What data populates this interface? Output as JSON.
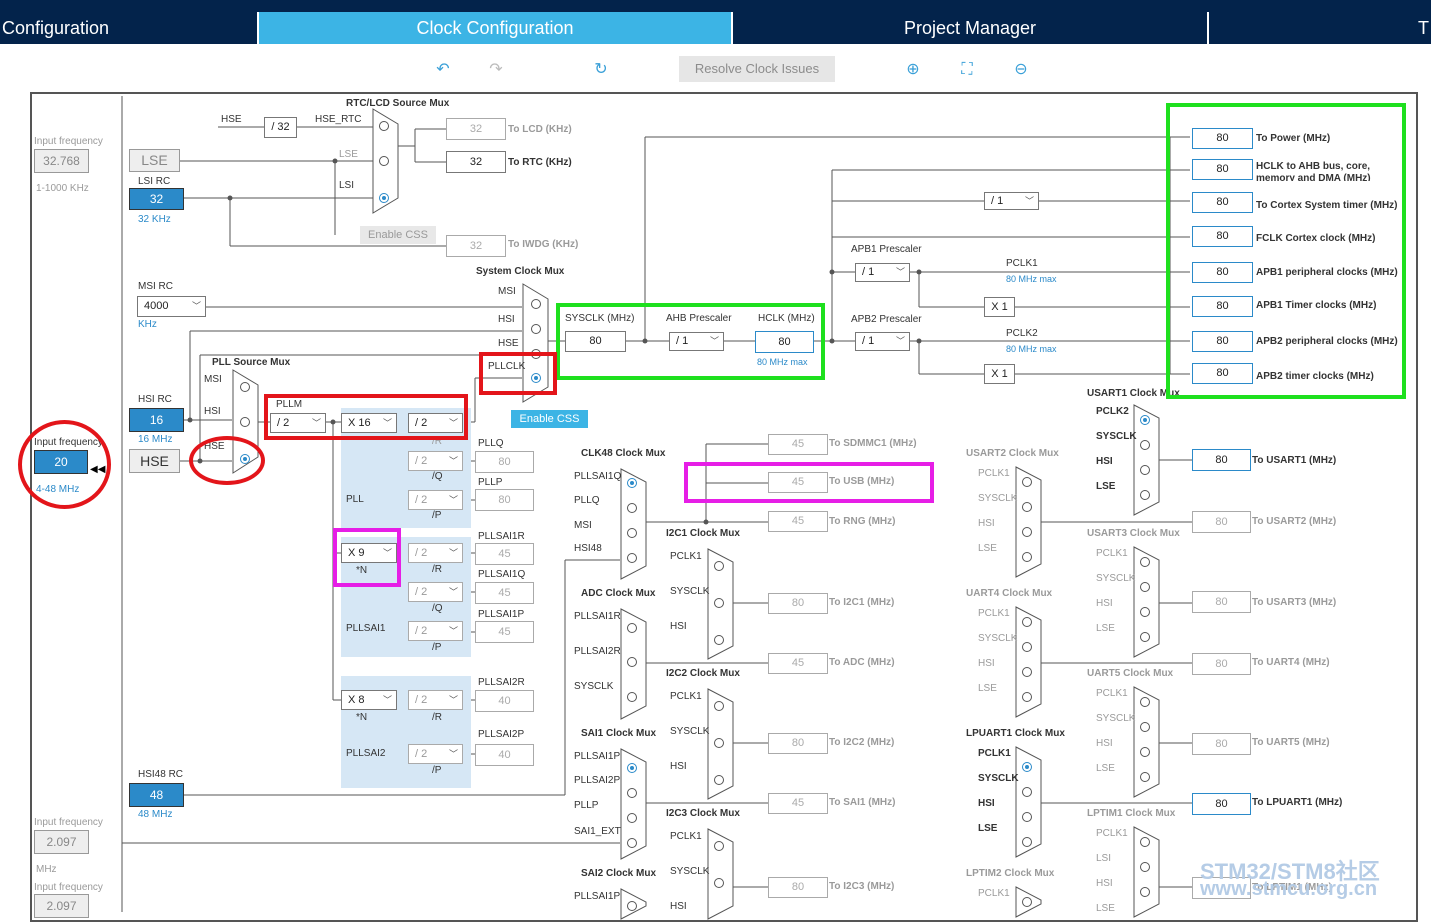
{
  "tabs": [
    "Configuration",
    "Clock Configuration",
    "Project Manager",
    "T"
  ],
  "toolbar": {
    "resolve": "Resolve Clock Issues"
  },
  "left": {
    "input_freq": "Input frequency",
    "lse_val": "32.768",
    "lse_range": "1-1000 KHz",
    "lse": "LSE",
    "lsi_rc": "LSI RC",
    "lsi_val": "32",
    "lsi_unit": "32 KHz",
    "msi_rc": "MSI RC",
    "msi_val": "4000",
    "msi_unit": "KHz",
    "hsi_rc": "HSI RC",
    "hsi_val": "16",
    "hsi_unit": "16 MHz",
    "hse_input_freq": "Input frequency",
    "hse_val": "20",
    "hse_range": "4-48 MHz",
    "hse": "HSE",
    "hsi48_rc": "HSI48 RC",
    "hsi48_val": "48",
    "hsi48_unit": "48 MHz",
    "sai_input_freq": "Input frequency",
    "sai_val": "2.097",
    "sai_unit": "MHz",
    "sai2_input_freq": "Input frequency",
    "sai2_val": "2.097"
  },
  "rtc": {
    "title": "RTC/LCD Source Mux",
    "hse": "HSE",
    "div32": "/ 32",
    "hse_rtc": "HSE_RTC",
    "lse": "LSE",
    "lsi": "LSI",
    "lcd_val": "32",
    "lcd_lbl": "To LCD (KHz)",
    "rtc_val": "32",
    "rtc_lbl": "To RTC (KHz)",
    "iwdg_val": "32",
    "iwdg_lbl": "To IWDG (KHz)",
    "enable_css": "Enable CSS"
  },
  "sysmux": {
    "title": "System Clock Mux",
    "msi": "MSI",
    "hsi": "HSI",
    "hse": "HSE",
    "pllclk": "PLLCLK",
    "enable_css": "Enable CSS"
  },
  "pll": {
    "source_mux": "PLL Source Mux",
    "msi": "MSI",
    "hsi": "HSI",
    "hse": "HSE",
    "pllm": "PLLM",
    "m": "/ 2",
    "n": "X 16",
    "r": "/ 2",
    "r_lbl": "/R",
    "pllq": "PLLQ",
    "q": "/ 2",
    "q_lbl": "/Q",
    "q_val": "80",
    "pllp": "PLLP",
    "p": "/ 2",
    "p_lbl": "/P",
    "p_val": "80",
    "pll": "PLL"
  },
  "pllsai1": {
    "n": "X 9",
    "n_lbl": "*N",
    "r": "/ 2",
    "r_lbl": "/R",
    "r_name": "PLLSAI1R",
    "r_val": "45",
    "q": "/ 2",
    "q_lbl": "/Q",
    "q_name": "PLLSAI1Q",
    "q_val": "45",
    "p": "/ 2",
    "p_lbl": "/P",
    "p_name": "PLLSAI1P",
    "p_val": "45",
    "name": "PLLSAI1"
  },
  "pllsai2": {
    "n": "X 8",
    "n_lbl": "*N",
    "r": "/ 2",
    "r_lbl": "/R",
    "r_name": "PLLSAI2R",
    "r_val": "40",
    "p": "/ 2",
    "p_lbl": "/P",
    "p_name": "PLLSAI2P",
    "p_val": "40",
    "name": "PLLSAI2"
  },
  "sysclk": {
    "title": "SYSCLK (MHz)",
    "val": "80",
    "ahb": "AHB Prescaler",
    "ahb_val": "/ 1",
    "hclk": "HCLK (MHz)",
    "hclk_val": "80",
    "max": "80 MHz max"
  },
  "apb": {
    "div": "/ 1",
    "apb1": "APB1 Prescaler",
    "apb1_val": "/ 1",
    "pclk1": "PCLK1",
    "pclk1_max": "80 MHz max",
    "x1a": "X 1",
    "apb2": "APB2 Prescaler",
    "apb2_val": "/ 1",
    "pclk2": "PCLK2",
    "pclk2_max": "80 MHz max",
    "x1b": "X 1"
  },
  "outputs": [
    {
      "val": "80",
      "lbl": "To Power (MHz)"
    },
    {
      "val": "80",
      "lbl": "HCLK to AHB bus, core, memory and DMA (MHz)"
    },
    {
      "val": "80",
      "lbl": "To Cortex System timer (MHz)"
    },
    {
      "val": "80",
      "lbl": "FCLK Cortex clock (MHz)"
    },
    {
      "val": "80",
      "lbl": "APB1 peripheral clocks (MHz)"
    },
    {
      "val": "80",
      "lbl": "APB1 Timer clocks (MHz)"
    },
    {
      "val": "80",
      "lbl": "APB2 peripheral clocks (MHz)"
    },
    {
      "val": "80",
      "lbl": "APB2 timer clocks (MHz)"
    }
  ],
  "clk48": {
    "title": "CLK48 Clock Mux",
    "in1": "PLLSAI1Q",
    "in2": "PLLQ",
    "in3": "MSI",
    "in4": "HSI48",
    "sdmmc_val": "45",
    "sdmmc_lbl": "To SDMMC1 (MHz)",
    "usb_val": "45",
    "usb_lbl": "To USB (MHz)",
    "rng_val": "45",
    "rng_lbl": "To RNG (MHz)"
  },
  "adc": {
    "title": "ADC Clock Mux",
    "in1": "PLLSAI1R",
    "in2": "PLLSAI2R",
    "in3": "SYSCLK",
    "val": "45",
    "lbl": "To ADC (MHz)"
  },
  "sai1": {
    "title": "SAI1 Clock Mux",
    "in1": "PLLSAI1P",
    "in2": "PLLSAI2P",
    "in3": "PLLP",
    "in4": "SAI1_EXT",
    "val": "45",
    "lbl": "To SAI1 (MHz)"
  },
  "sai2": {
    "title": "SAI2 Clock Mux",
    "in1": "PLLSAI1P"
  },
  "i2c1": {
    "title": "I2C1 Clock Mux",
    "in1": "PCLK1",
    "in2": "SYSCLK",
    "in3": "HSI",
    "val": "80",
    "lbl": "To I2C1 (MHz)"
  },
  "i2c2": {
    "title": "I2C2 Clock Mux",
    "in1": "PCLK1",
    "in2": "SYSCLK",
    "in3": "HSI",
    "val": "80",
    "lbl": "To I2C2 (MHz)"
  },
  "i2c3": {
    "title": "I2C3 Clock Mux",
    "in1": "PCLK1",
    "in2": "SYSCLK",
    "in3": "HSI",
    "val": "80",
    "lbl": "To I2C3 (MHz)"
  },
  "usart1": {
    "title": "USART1 Clock Mux",
    "in1": "PCLK2",
    "in2": "SYSCLK",
    "in3": "HSI",
    "in4": "LSE",
    "val": "80",
    "lbl": "To USART1 (MHz)"
  },
  "usart2": {
    "title": "USART2 Clock Mux",
    "in1": "PCLK1",
    "in2": "SYSCLK",
    "in3": "HSI",
    "in4": "LSE",
    "val": "80",
    "lbl": "To USART2 (MHz)"
  },
  "usart3": {
    "title": "USART3 Clock Mux",
    "in1": "PCLK1",
    "in2": "SYSCLK",
    "in3": "HSI",
    "in4": "LSE",
    "val": "80",
    "lbl": "To USART3 (MHz)"
  },
  "uart4": {
    "title": "UART4 Clock Mux",
    "in1": "PCLK1",
    "in2": "SYSCLK",
    "in3": "HSI",
    "in4": "LSE",
    "val": "80",
    "lbl": "To UART4 (MHz)"
  },
  "uart5": {
    "title": "UART5 Clock Mux",
    "in1": "PCLK1",
    "in2": "SYSCLK",
    "in3": "HSI",
    "in4": "LSE",
    "val": "80",
    "lbl": "To UART5 (MHz)"
  },
  "lpuart1": {
    "title": "LPUART1 Clock Mux",
    "in1": "PCLK1",
    "in2": "SYSCLK",
    "in3": "HSI",
    "in4": "LSE",
    "val": "80",
    "lbl": "To LPUART1 (MHz)"
  },
  "lptim1": {
    "title": "LPTIM1 Clock Mux",
    "in1": "PCLK1",
    "in2": "LSI",
    "in3": "HSI",
    "in4": "LSE",
    "lbl": "To LPTIM1 (MHz)"
  },
  "lptim2": {
    "title": "LPTIM2 Clock Mux",
    "in1": "PCLK1"
  },
  "watermark": {
    "line1": "STM32/STM8社区",
    "line2": "www.stmcu.org.cn"
  },
  "colors": {
    "navy": "#03234b",
    "tab_active": "#3cb4e5",
    "blue": "#2b8ac9",
    "red": "#e3151a",
    "green": "#1ee01e",
    "magenta": "#e61ee6"
  }
}
